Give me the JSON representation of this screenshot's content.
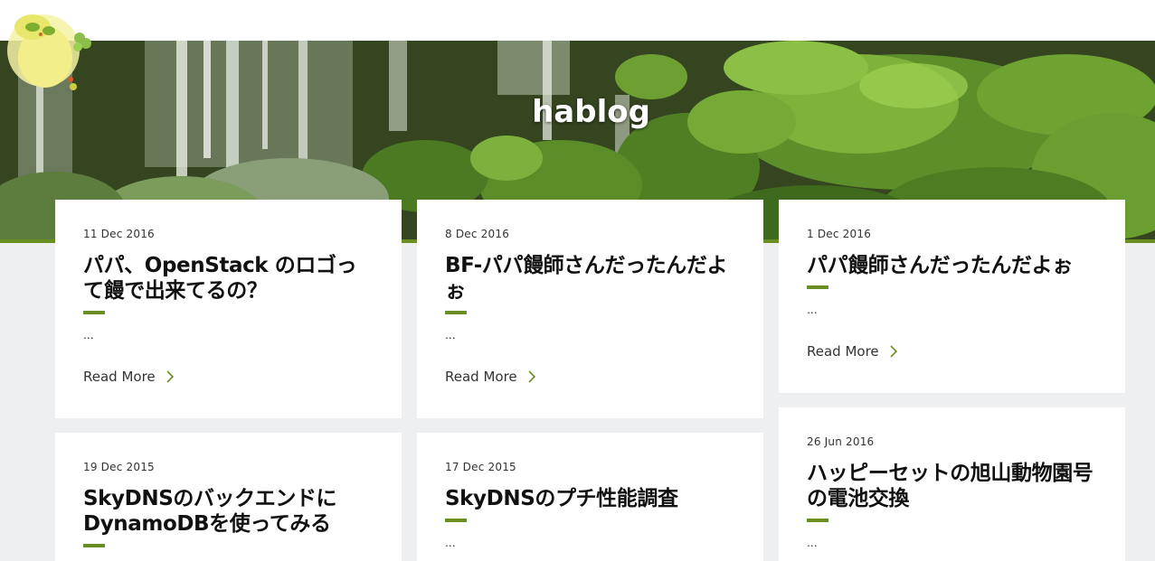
{
  "site": {
    "title": "hablog"
  },
  "colors": {
    "accent": "#6b8e23",
    "background": "#eeeff1",
    "card": "#ffffff",
    "title_text": "#ffffff"
  },
  "posts": [
    {
      "date": "11 Dec 2016",
      "title": "パパ、OpenStack のロゴって饅で出来てるの？",
      "excerpt": "...",
      "read_more": "Read More"
    },
    {
      "date": "8 Dec 2016",
      "title": "BF-パパ饅師さんだったんだよぉ",
      "excerpt": "...",
      "read_more": "Read More"
    },
    {
      "date": "1 Dec 2016",
      "title": "パパ饅師さんだったんだよぉ",
      "excerpt": "...",
      "read_more": "Read More"
    },
    {
      "date": "19 Dec 2015",
      "title": "SkyDNSのバックエンドにDynamoDBを使ってみる",
      "excerpt": "",
      "read_more": ""
    },
    {
      "date": "17 Dec 2015",
      "title": "SkyDNSのプチ性能調査",
      "excerpt": "...",
      "read_more": ""
    },
    {
      "date": "26 Jun 2016",
      "title": "ハッピーセットの旭山動物園号の電池交換",
      "excerpt": "...",
      "read_more": ""
    }
  ]
}
